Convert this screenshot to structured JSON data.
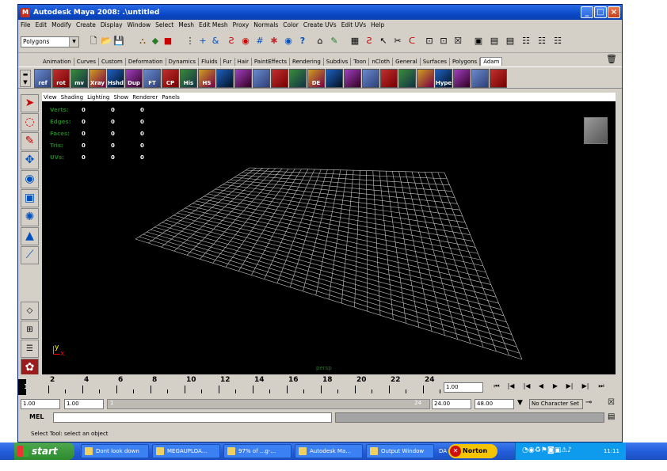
{
  "window": {
    "title": "Autodesk Maya 2008: .\\untitled",
    "controls": [
      "_",
      "□",
      "×"
    ]
  },
  "menubar": [
    "File",
    "Edit",
    "Modify",
    "Create",
    "Display",
    "Window",
    "Select",
    "Mesh",
    "Edit Mesh",
    "Proxy",
    "Normals",
    "Color",
    "Create UVs",
    "Edit UVs",
    "Help"
  ],
  "toolbar": {
    "menu_set": "Polygons"
  },
  "shelf_tabs": [
    "Animation",
    "Curves",
    "Custom",
    "Deformation",
    "Dynamics",
    "Fluids",
    "Fur",
    "Hair",
    "PaintEffects",
    "Rendering",
    "Subdivs",
    "Toon",
    "nCloth",
    "General",
    "Surfaces",
    "Polygons",
    "Adam"
  ],
  "shelf_tab_selected": "Adam",
  "shelf_items": [
    "ref",
    "rot",
    "mv",
    "Xray",
    "Hshd",
    "Dup",
    "FT",
    "CP",
    "His",
    "HS",
    "",
    "",
    "",
    "",
    "",
    "DE",
    "",
    "",
    "",
    "",
    "",
    "",
    "Hypersh",
    "",
    "",
    ""
  ],
  "viewport_menu": [
    "View",
    "Shading",
    "Lighting",
    "Show",
    "Renderer",
    "Panels"
  ],
  "hud": [
    {
      "label": "Verts:",
      "a": "0",
      "b": "0",
      "c": "0"
    },
    {
      "label": "Edges:",
      "a": "0",
      "b": "0",
      "c": "0"
    },
    {
      "label": "Faces:",
      "a": "0",
      "b": "0",
      "c": "0"
    },
    {
      "label": "Tris:",
      "a": "0",
      "b": "0",
      "c": "0"
    },
    {
      "label": "UVs:",
      "a": "0",
      "b": "0",
      "c": "0"
    }
  ],
  "camera_label": "persp",
  "axis": {
    "y": "y",
    "x": "x"
  },
  "timeline": {
    "current_frame": "1",
    "ticks": [
      "2",
      "4",
      "6",
      "8",
      "10",
      "12",
      "14",
      "16",
      "18",
      "20",
      "22",
      "24"
    ],
    "current_time_field": "1.00"
  },
  "range": {
    "start_time": "1.00",
    "playback_start": "1.00",
    "slider_start": "1",
    "slider_end": "24",
    "playback_end": "24.00",
    "end_time": "48.00",
    "character_set": "No Character Set"
  },
  "command_line": {
    "label": "MEL"
  },
  "help_line": "Select Tool: select an object",
  "taskbar": {
    "start": "start",
    "tasks": [
      "Dont look down",
      "MEGAUPLOA...",
      "97% of ...g-...",
      "Autodesk Ma...",
      "Output Window"
    ],
    "tray_label": "DA",
    "norton": "Norton",
    "clock": "11:11"
  },
  "colors": {
    "titlebar": "#0b49c8",
    "viewport": "#000000",
    "grid": "#c8c8c8",
    "hud_label": "#1e7a1e",
    "taskbar": "#245edb",
    "start": "#2e8b2e"
  }
}
